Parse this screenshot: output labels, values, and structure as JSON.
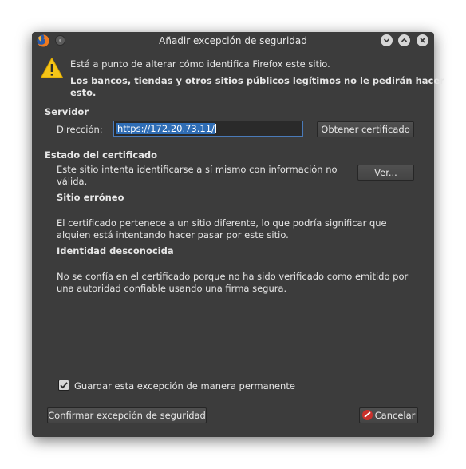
{
  "window": {
    "title": "Añadir excepción de seguridad"
  },
  "warning": {
    "line1": "Está a punto de alterar cómo identifica Firefox este sitio.",
    "line2a": "Los bancos, tiendas y otros sitios públicos legítimos no le pedirán hacer",
    "line2b": "esto."
  },
  "server": {
    "heading": "Servidor",
    "address_label": "Dirección:",
    "address_value": "https://172.20.73.11/",
    "get_cert_button": "Obtener certificado"
  },
  "cert_status": {
    "heading": "Estado del certificado",
    "desc_line1": "Este sitio intenta identificarse a sí mismo con información no",
    "desc_line2": "válida.",
    "view_button": "Ver...",
    "wrong_site_heading": "Sitio erróneo",
    "wrong_site_line1": "El certificado pertenece a un sitio diferente, lo que podría significar que",
    "wrong_site_line2": "alquien está intentando hacer pasar por este sitio.",
    "unknown_identity_heading": "Identidad desconocida",
    "unknown_identity_line1": "No se confía en el certificado porque no ha sido verificado como emitido por",
    "unknown_identity_line2": "una autoridad confiable usando una firma segura."
  },
  "permanent": {
    "label": "Guardar esta excepción de manera permanente",
    "checked": true
  },
  "footer": {
    "confirm_button": "Confirmar excepción de seguridad",
    "cancel_button": "Cancelar"
  },
  "colors": {
    "window_bg": "#3c3c3c",
    "selection": "#2f6db5",
    "warning_yellow": "#f5c518",
    "cancel_red": "#c9302c"
  },
  "icons": {
    "app": "firefox-icon",
    "warning": "warning-triangle-icon",
    "minimize": "chevron-down-icon",
    "maximize": "chevron-up-icon",
    "close": "close-icon",
    "cancel": "cancel-icon"
  }
}
